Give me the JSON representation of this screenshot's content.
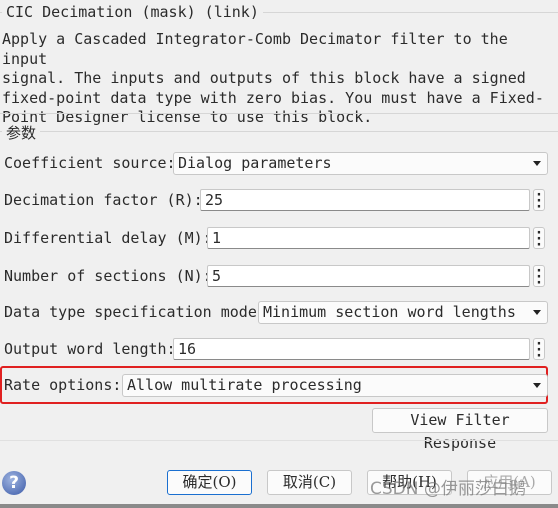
{
  "header": {
    "title": "CIC Decimation (mask) (link)",
    "description": "Apply a Cascaded Integrator-Comb Decimator filter to the input\nsignal. The inputs and outputs of this block have a signed\nfixed-point data type with zero bias. You must have a Fixed-\nPoint Designer license to use this block."
  },
  "params": {
    "title": "参数",
    "coefficient_source": {
      "label": "Coefficient source:",
      "value": "Dialog parameters"
    },
    "decimation_factor": {
      "label": "Decimation factor (R):",
      "value": "25"
    },
    "differential_delay": {
      "label": "Differential delay (M):",
      "value": "1"
    },
    "num_sections": {
      "label": "Number of sections (N):",
      "value": "5"
    },
    "data_type_mode": {
      "label": "Data type specification mode:",
      "value": "Minimum section word lengths"
    },
    "output_word_length": {
      "label": "Output word length:",
      "value": "16"
    },
    "rate_options": {
      "label": "Rate options:",
      "value": "Allow multirate processing"
    },
    "view_filter_response": "View Filter Response"
  },
  "highlight_color": "#e02020",
  "buttons": {
    "ok": "确定(O)",
    "cancel": "取消(C)",
    "help": "帮助(H)",
    "apply": "应用(A)"
  },
  "watermark": "CSDN @伊丽莎白鹅"
}
